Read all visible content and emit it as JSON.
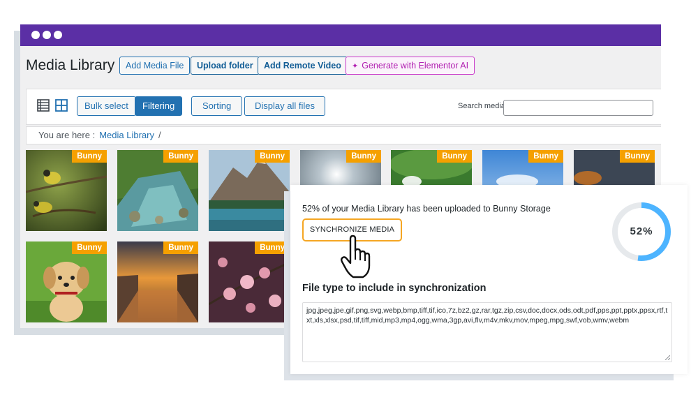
{
  "app": {
    "page_title": "Media Library"
  },
  "header_buttons": {
    "add_media_file": "Add Media File",
    "upload_folder": "Upload folder",
    "add_remote_video": "Add Remote Video",
    "generate_ai": "Generate with Elementor AI"
  },
  "toolbar": {
    "bulk_select": "Bulk select",
    "filtering": "Filtering",
    "sorting": "Sorting",
    "display_all": "Display all files",
    "search_label": "Search media",
    "search_value": ""
  },
  "breadcrumb": {
    "prefix": "You are here :",
    "link": "Media Library",
    "separator": "/"
  },
  "media": {
    "badge": "Bunny",
    "items": [
      {
        "name": "bird"
      },
      {
        "name": "river"
      },
      {
        "name": "mountain-lake"
      },
      {
        "name": "sun-clouds"
      },
      {
        "name": "lotus"
      },
      {
        "name": "sky"
      },
      {
        "name": "rock-sunset"
      },
      {
        "name": "puppy"
      },
      {
        "name": "canal-sunset"
      },
      {
        "name": "cherry-blossom"
      }
    ]
  },
  "sync": {
    "status_text": "52% of your Media Library has been uploaded to Bunny Storage",
    "button_label": "SYNCHRONIZE MEDIA",
    "progress_percent": 52,
    "progress_label": "52%",
    "file_type_title": "File type to include in synchronization",
    "file_types": "jpg,jpeg,jpe,gif,png,svg,webp,bmp,tiff,tif,ico,7z,bz2,gz,rar,tgz,zip,csv,doc,docx,ods,odt,pdf,pps,ppt,pptx,ppsx,rtf,txt,xls,xlsx,psd,tif,tiff,mid,mp3,mp4,ogg,wma,3gp,avi,flv,m4v,mkv,mov,mpeg,mpg,swf,vob,wmv,webm"
  },
  "colors": {
    "titlebar": "#5b2fa5",
    "wp_blue": "#2271b1",
    "badge_orange": "#f5a000",
    "sync_border": "#f5a623",
    "progress_blue": "#4db4ff",
    "ai_magenta": "#c936c9"
  },
  "icons": {
    "list_view": "list-view-icon",
    "grid_view": "grid-view-icon",
    "ai_spark": "sparkle-icon",
    "hand_cursor": "hand-pointer-icon"
  }
}
